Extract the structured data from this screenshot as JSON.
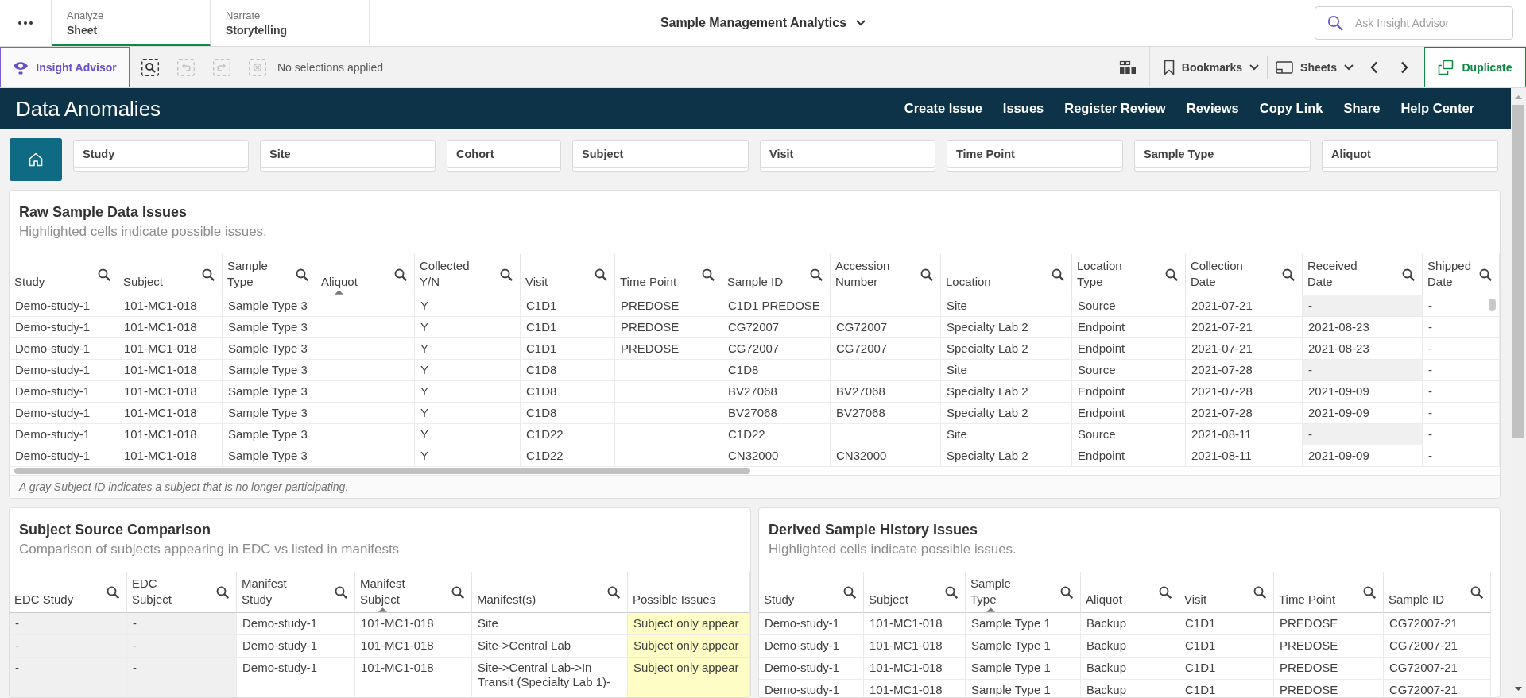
{
  "top_bar": {
    "tabs": [
      {
        "label": "Analyze",
        "mode": "Sheet",
        "selected": true
      },
      {
        "label": "Narrate",
        "mode": "Storytelling",
        "selected": false
      }
    ],
    "app_title": "Sample Management Analytics",
    "search": {
      "placeholder": "Ask Insight Advisor"
    }
  },
  "toolbar": {
    "insight_advisor": "Insight Advisor",
    "tools": [
      {
        "kind": "search",
        "disabled": false
      },
      {
        "kind": "back",
        "disabled": true
      },
      {
        "kind": "forward",
        "disabled": true
      },
      {
        "kind": "clear",
        "disabled": true
      }
    ],
    "selections": "No selections applied",
    "bookmarks": "Bookmarks",
    "sheets": "Sheets",
    "duplicate": "Duplicate"
  },
  "header": {
    "title": "Data Anomalies",
    "links": [
      "Create Issue",
      "Issues",
      "Register Review",
      "Reviews",
      "Copy Link",
      "Share",
      "Help Center"
    ]
  },
  "filters": [
    "Study",
    "Site",
    "Cohort",
    "Subject",
    "Visit",
    "Time Point",
    "Sample Type",
    "Aliquot"
  ],
  "raw_sample_panel": {
    "title": "Raw Sample Data Issues",
    "subtitle": "Highlighted cells indicate possible issues.",
    "columns": [
      {
        "label": "Study",
        "searchable": true,
        "sorted": false
      },
      {
        "label": "Subject",
        "searchable": true,
        "sorted": false
      },
      {
        "label": "Sample Type",
        "searchable": true,
        "sorted": false
      },
      {
        "label": "Aliquot",
        "searchable": true,
        "sorted": true
      },
      {
        "label": "Collected Y/N",
        "searchable": true,
        "sorted": false
      },
      {
        "label": "Visit",
        "searchable": true,
        "sorted": false
      },
      {
        "label": "Time Point",
        "searchable": true,
        "sorted": false
      },
      {
        "label": "Sample ID",
        "searchable": true,
        "sorted": false
      },
      {
        "label": "Accession Number",
        "searchable": true,
        "sorted": false
      },
      {
        "label": "Location",
        "searchable": true,
        "sorted": false
      },
      {
        "label": "Location Type",
        "searchable": true,
        "sorted": false
      },
      {
        "label": "Collection Date",
        "searchable": true,
        "sorted": false
      },
      {
        "label": "Received Date",
        "searchable": true,
        "sorted": false
      },
      {
        "label": "Shipped Date",
        "searchable": true,
        "sorted": false
      }
    ],
    "rows": [
      {
        "cells": [
          {
            "text": "Demo-study-1"
          },
          {
            "text": "101-MC1-018"
          },
          {
            "text": "Sample Type 3"
          },
          {},
          {
            "text": "Y"
          },
          {
            "text": "C1D1"
          },
          {
            "text": "PREDOSE"
          },
          {
            "text": "C1D1 PREDOSE"
          },
          {},
          {
            "text": "Site"
          },
          {
            "text": "Source"
          },
          {
            "text": "2021-07-21"
          },
          {
            "text": "-",
            "color": "#f0f0f0"
          },
          {
            "text": "-"
          }
        ]
      },
      {
        "cells": [
          {
            "text": "Demo-study-1"
          },
          {
            "text": "101-MC1-018"
          },
          {
            "text": "Sample Type 3"
          },
          {},
          {
            "text": "Y"
          },
          {
            "text": "C1D1"
          },
          {
            "text": "PREDOSE"
          },
          {
            "text": "CG72007"
          },
          {
            "text": "CG72007"
          },
          {
            "text": "Specialty Lab 2"
          },
          {
            "text": "Endpoint"
          },
          {
            "text": "2021-07-21"
          },
          {
            "text": "2021-08-23"
          },
          {
            "text": "-"
          }
        ]
      },
      {
        "cells": [
          {
            "text": "Demo-study-1"
          },
          {
            "text": "101-MC1-018"
          },
          {
            "text": "Sample Type 3"
          },
          {},
          {
            "text": "Y"
          },
          {
            "text": "C1D1"
          },
          {
            "text": "PREDOSE"
          },
          {
            "text": "CG72007"
          },
          {
            "text": "CG72007"
          },
          {
            "text": "Specialty Lab 2"
          },
          {
            "text": "Endpoint"
          },
          {
            "text": "2021-07-21"
          },
          {
            "text": "2021-08-23"
          },
          {
            "text": "-"
          }
        ]
      },
      {
        "cells": [
          {
            "text": "Demo-study-1"
          },
          {
            "text": "101-MC1-018"
          },
          {
            "text": "Sample Type 3"
          },
          {},
          {
            "text": "Y"
          },
          {
            "text": "C1D8"
          },
          {},
          {
            "text": "C1D8"
          },
          {},
          {
            "text": "Site"
          },
          {
            "text": "Source"
          },
          {
            "text": "2021-07-28"
          },
          {
            "text": "-",
            "color": "#f0f0f0"
          },
          {
            "text": "-"
          }
        ]
      },
      {
        "cells": [
          {
            "text": "Demo-study-1"
          },
          {
            "text": "101-MC1-018"
          },
          {
            "text": "Sample Type 3"
          },
          {},
          {
            "text": "Y"
          },
          {
            "text": "C1D8"
          },
          {},
          {
            "text": "BV27068"
          },
          {
            "text": "BV27068"
          },
          {
            "text": "Specialty Lab 2"
          },
          {
            "text": "Endpoint"
          },
          {
            "text": "2021-07-28"
          },
          {
            "text": "2021-09-09"
          },
          {
            "text": "-"
          }
        ]
      },
      {
        "cells": [
          {
            "text": "Demo-study-1"
          },
          {
            "text": "101-MC1-018"
          },
          {
            "text": "Sample Type 3"
          },
          {},
          {
            "text": "Y"
          },
          {
            "text": "C1D8"
          },
          {},
          {
            "text": "BV27068"
          },
          {
            "text": "BV27068"
          },
          {
            "text": "Specialty Lab 2"
          },
          {
            "text": "Endpoint"
          },
          {
            "text": "2021-07-28"
          },
          {
            "text": "2021-09-09"
          },
          {
            "text": "-"
          }
        ]
      },
      {
        "cells": [
          {
            "text": "Demo-study-1"
          },
          {
            "text": "101-MC1-018"
          },
          {
            "text": "Sample Type 3"
          },
          {},
          {
            "text": "Y"
          },
          {
            "text": "C1D22"
          },
          {},
          {
            "text": "C1D22"
          },
          {},
          {
            "text": "Site"
          },
          {
            "text": "Source"
          },
          {
            "text": "2021-08-11"
          },
          {
            "text": "-",
            "color": "#f0f0f0"
          },
          {
            "text": "-"
          }
        ]
      },
      {
        "cells": [
          {
            "text": "Demo-study-1"
          },
          {
            "text": "101-MC1-018"
          },
          {
            "text": "Sample Type 3"
          },
          {},
          {
            "text": "Y"
          },
          {
            "text": "C1D22"
          },
          {},
          {
            "text": "CN32000"
          },
          {
            "text": "CN32000"
          },
          {
            "text": "Specialty Lab 2"
          },
          {
            "text": "Endpoint"
          },
          {
            "text": "2021-08-11"
          },
          {
            "text": "2021-09-09"
          },
          {
            "text": "-"
          }
        ]
      }
    ],
    "footnote": "A gray Subject ID indicates a subject that is no longer participating."
  },
  "subject_source_panel": {
    "title": "Subject Source Comparison",
    "subtitle": "Comparison of subjects appearing in EDC vs listed in manifests",
    "columns": [
      {
        "label": "EDC Study",
        "searchable": true,
        "sorted": false
      },
      {
        "label": "EDC Subject",
        "searchable": true,
        "sorted": false
      },
      {
        "label": "Manifest Study",
        "searchable": true,
        "sorted": false
      },
      {
        "label": "Manifest Subject",
        "searchable": true,
        "sorted": true
      },
      {
        "label": "Manifest(s)",
        "searchable": true,
        "sorted": false
      },
      {
        "label": "Possible Issues",
        "searchable": false,
        "sorted": false
      }
    ],
    "rows": [
      {
        "cells": [
          {
            "text": "-",
            "color": "#f0f0f0"
          },
          {
            "text": "-",
            "color": "#f0f0f0"
          },
          {
            "text": "Demo-study-1"
          },
          {
            "text": "101-MC1-018"
          },
          {
            "text": "Site"
          },
          {
            "text": "Subject only appear",
            "color": "#fdfdc5"
          }
        ]
      },
      {
        "cells": [
          {
            "text": "-",
            "color": "#f0f0f0"
          },
          {
            "text": "-",
            "color": "#f0f0f0"
          },
          {
            "text": "Demo-study-1"
          },
          {
            "text": "101-MC1-018"
          },
          {
            "text": "Site->Central Lab"
          },
          {
            "text": "Subject only appear",
            "color": "#fdfdc5"
          }
        ]
      },
      {
        "cells": [
          {
            "text": "-",
            "color": "#f0f0f0"
          },
          {
            "text": "-",
            "color": "#f0f0f0"
          },
          {
            "text": "Demo-study-1"
          },
          {
            "text": "101-MC1-018"
          },
          {
            "text": "Site->Central Lab->In Transit (Specialty Lab 1)-"
          },
          {
            "text": "Subject only appear",
            "color": "#fdfdc5"
          }
        ]
      }
    ]
  },
  "derived_history_panel": {
    "title": "Derived Sample History Issues",
    "subtitle": "Highlighted cells indicate possible issues.",
    "columns": [
      {
        "label": "Study",
        "searchable": true,
        "sorted": false
      },
      {
        "label": "Subject",
        "searchable": true,
        "sorted": false
      },
      {
        "label": "Sample Type",
        "searchable": true,
        "sorted": true
      },
      {
        "label": "Aliquot",
        "searchable": true,
        "sorted": false
      },
      {
        "label": "Visit",
        "searchable": true,
        "sorted": false
      },
      {
        "label": "Time Point",
        "searchable": true,
        "sorted": false
      },
      {
        "label": "Sample ID",
        "searchable": true,
        "sorted": false
      }
    ],
    "rows": [
      {
        "cells": [
          {
            "text": "Demo-study-1"
          },
          {
            "text": "101-MC1-018"
          },
          {
            "text": "Sample Type 1"
          },
          {
            "text": "Backup"
          },
          {
            "text": "C1D1"
          },
          {
            "text": "PREDOSE"
          },
          {
            "text": "CG72007-21"
          }
        ]
      },
      {
        "cells": [
          {
            "text": "Demo-study-1"
          },
          {
            "text": "101-MC1-018"
          },
          {
            "text": "Sample Type 1"
          },
          {
            "text": "Backup"
          },
          {
            "text": "C1D1"
          },
          {
            "text": "PREDOSE"
          },
          {
            "text": "CG72007-21"
          }
        ]
      },
      {
        "cells": [
          {
            "text": "Demo-study-1"
          },
          {
            "text": "101-MC1-018"
          },
          {
            "text": "Sample Type 1"
          },
          {
            "text": "Backup"
          },
          {
            "text": "C1D1"
          },
          {
            "text": "PREDOSE"
          },
          {
            "text": "CG72007-21"
          }
        ]
      },
      {
        "cells": [
          {
            "text": "Demo-study-1"
          },
          {
            "text": "101-MC1-018"
          },
          {
            "text": "Sample Type 1"
          },
          {
            "text": "Backup"
          },
          {
            "text": "C1D1"
          },
          {
            "text": "PREDOSE"
          },
          {
            "text": "CG72007-21"
          }
        ]
      }
    ]
  }
}
